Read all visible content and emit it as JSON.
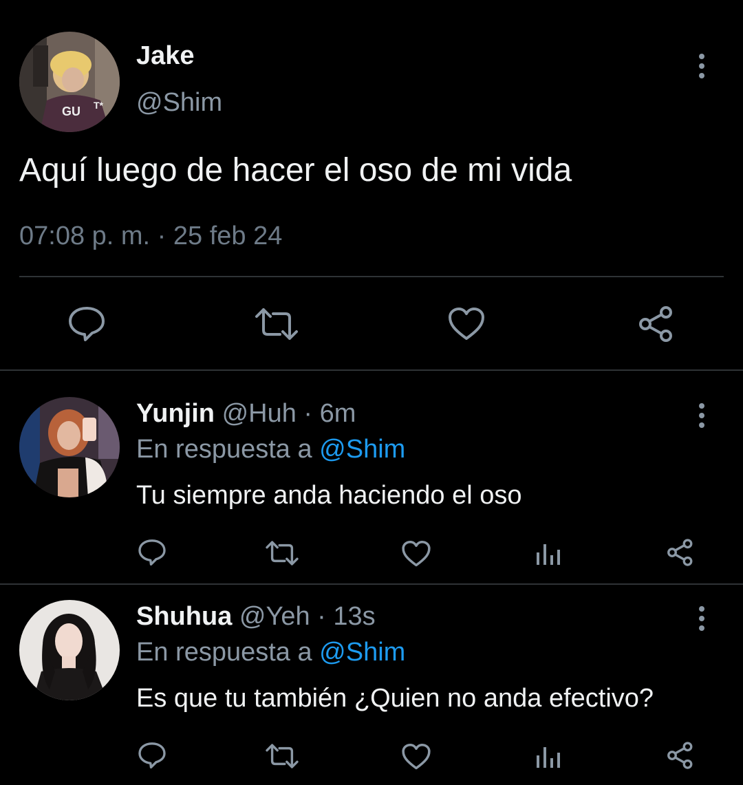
{
  "tweet": {
    "name": "Jake",
    "handle": "@Shim",
    "text": "Aquí luego de hacer el oso de mi vida",
    "timestamp": "07:08 p. m. · 25 feb 24",
    "actions": [
      "reply-icon",
      "retweet-icon",
      "like-icon",
      "share-icon"
    ]
  },
  "replies": [
    {
      "name": "Yunjin",
      "handle": "@Huh",
      "separator": " · ",
      "time": "6m",
      "reply_prefix": "En respuesta a ",
      "reply_to": "@Shim",
      "text": "Tu siempre anda haciendo el oso",
      "actions": [
        "reply-icon",
        "retweet-icon",
        "like-icon",
        "views-icon",
        "share-icon"
      ]
    },
    {
      "name": "Shuhua",
      "handle": "@Yeh",
      "separator": " · ",
      "time": "13s",
      "reply_prefix": "En respuesta a ",
      "reply_to": "@Shim",
      "text": "Es que tu también ¿Quien no anda efectivo?",
      "actions": [
        "reply-icon",
        "retweet-icon",
        "like-icon",
        "views-icon",
        "share-icon"
      ]
    }
  ],
  "colors": {
    "background": "#000000",
    "text": "#f0f2f3",
    "secondary": "#8b98a5",
    "link": "#1d9bf0",
    "divider": "#2f3336"
  }
}
